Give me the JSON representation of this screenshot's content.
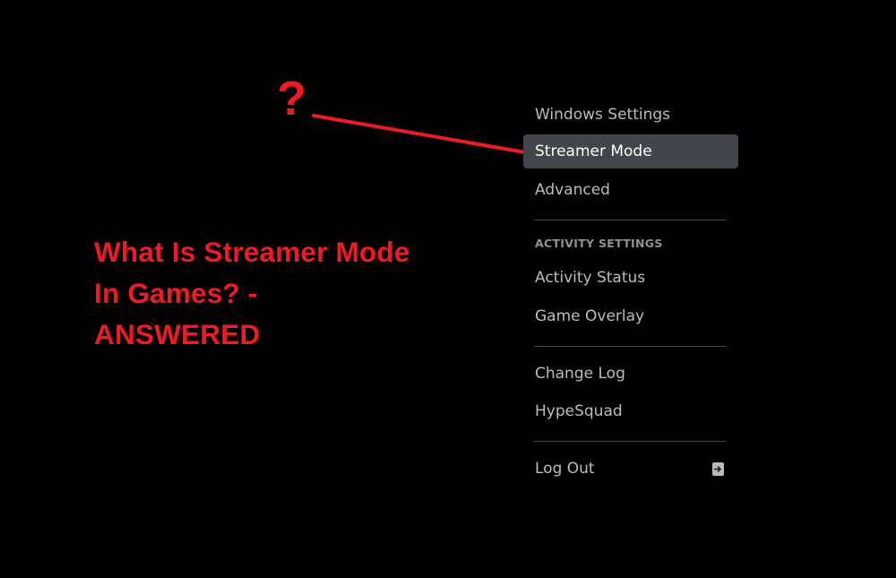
{
  "annotation": {
    "question_mark": "?",
    "headline": "What Is Streamer Mode In Games? - ANSWERED",
    "accent_color": "#ed1c24"
  },
  "menu": {
    "items_group1": [
      {
        "label": "Windows Settings",
        "selected": false
      },
      {
        "label": "Streamer Mode",
        "selected": true
      },
      {
        "label": "Advanced",
        "selected": false
      }
    ],
    "activity_header": "ACTIVITY SETTINGS",
    "items_group2": [
      {
        "label": "Activity Status"
      },
      {
        "label": "Game Overlay"
      }
    ],
    "items_group3": [
      {
        "label": "Change Log"
      },
      {
        "label": "HypeSquad"
      }
    ],
    "logout": {
      "label": "Log Out",
      "icon": "logout-icon"
    },
    "colors": {
      "selected_bg": "#42454c",
      "text": "#b9bbbe",
      "selected_text": "#ffffff",
      "header_text": "#8e9297"
    }
  }
}
